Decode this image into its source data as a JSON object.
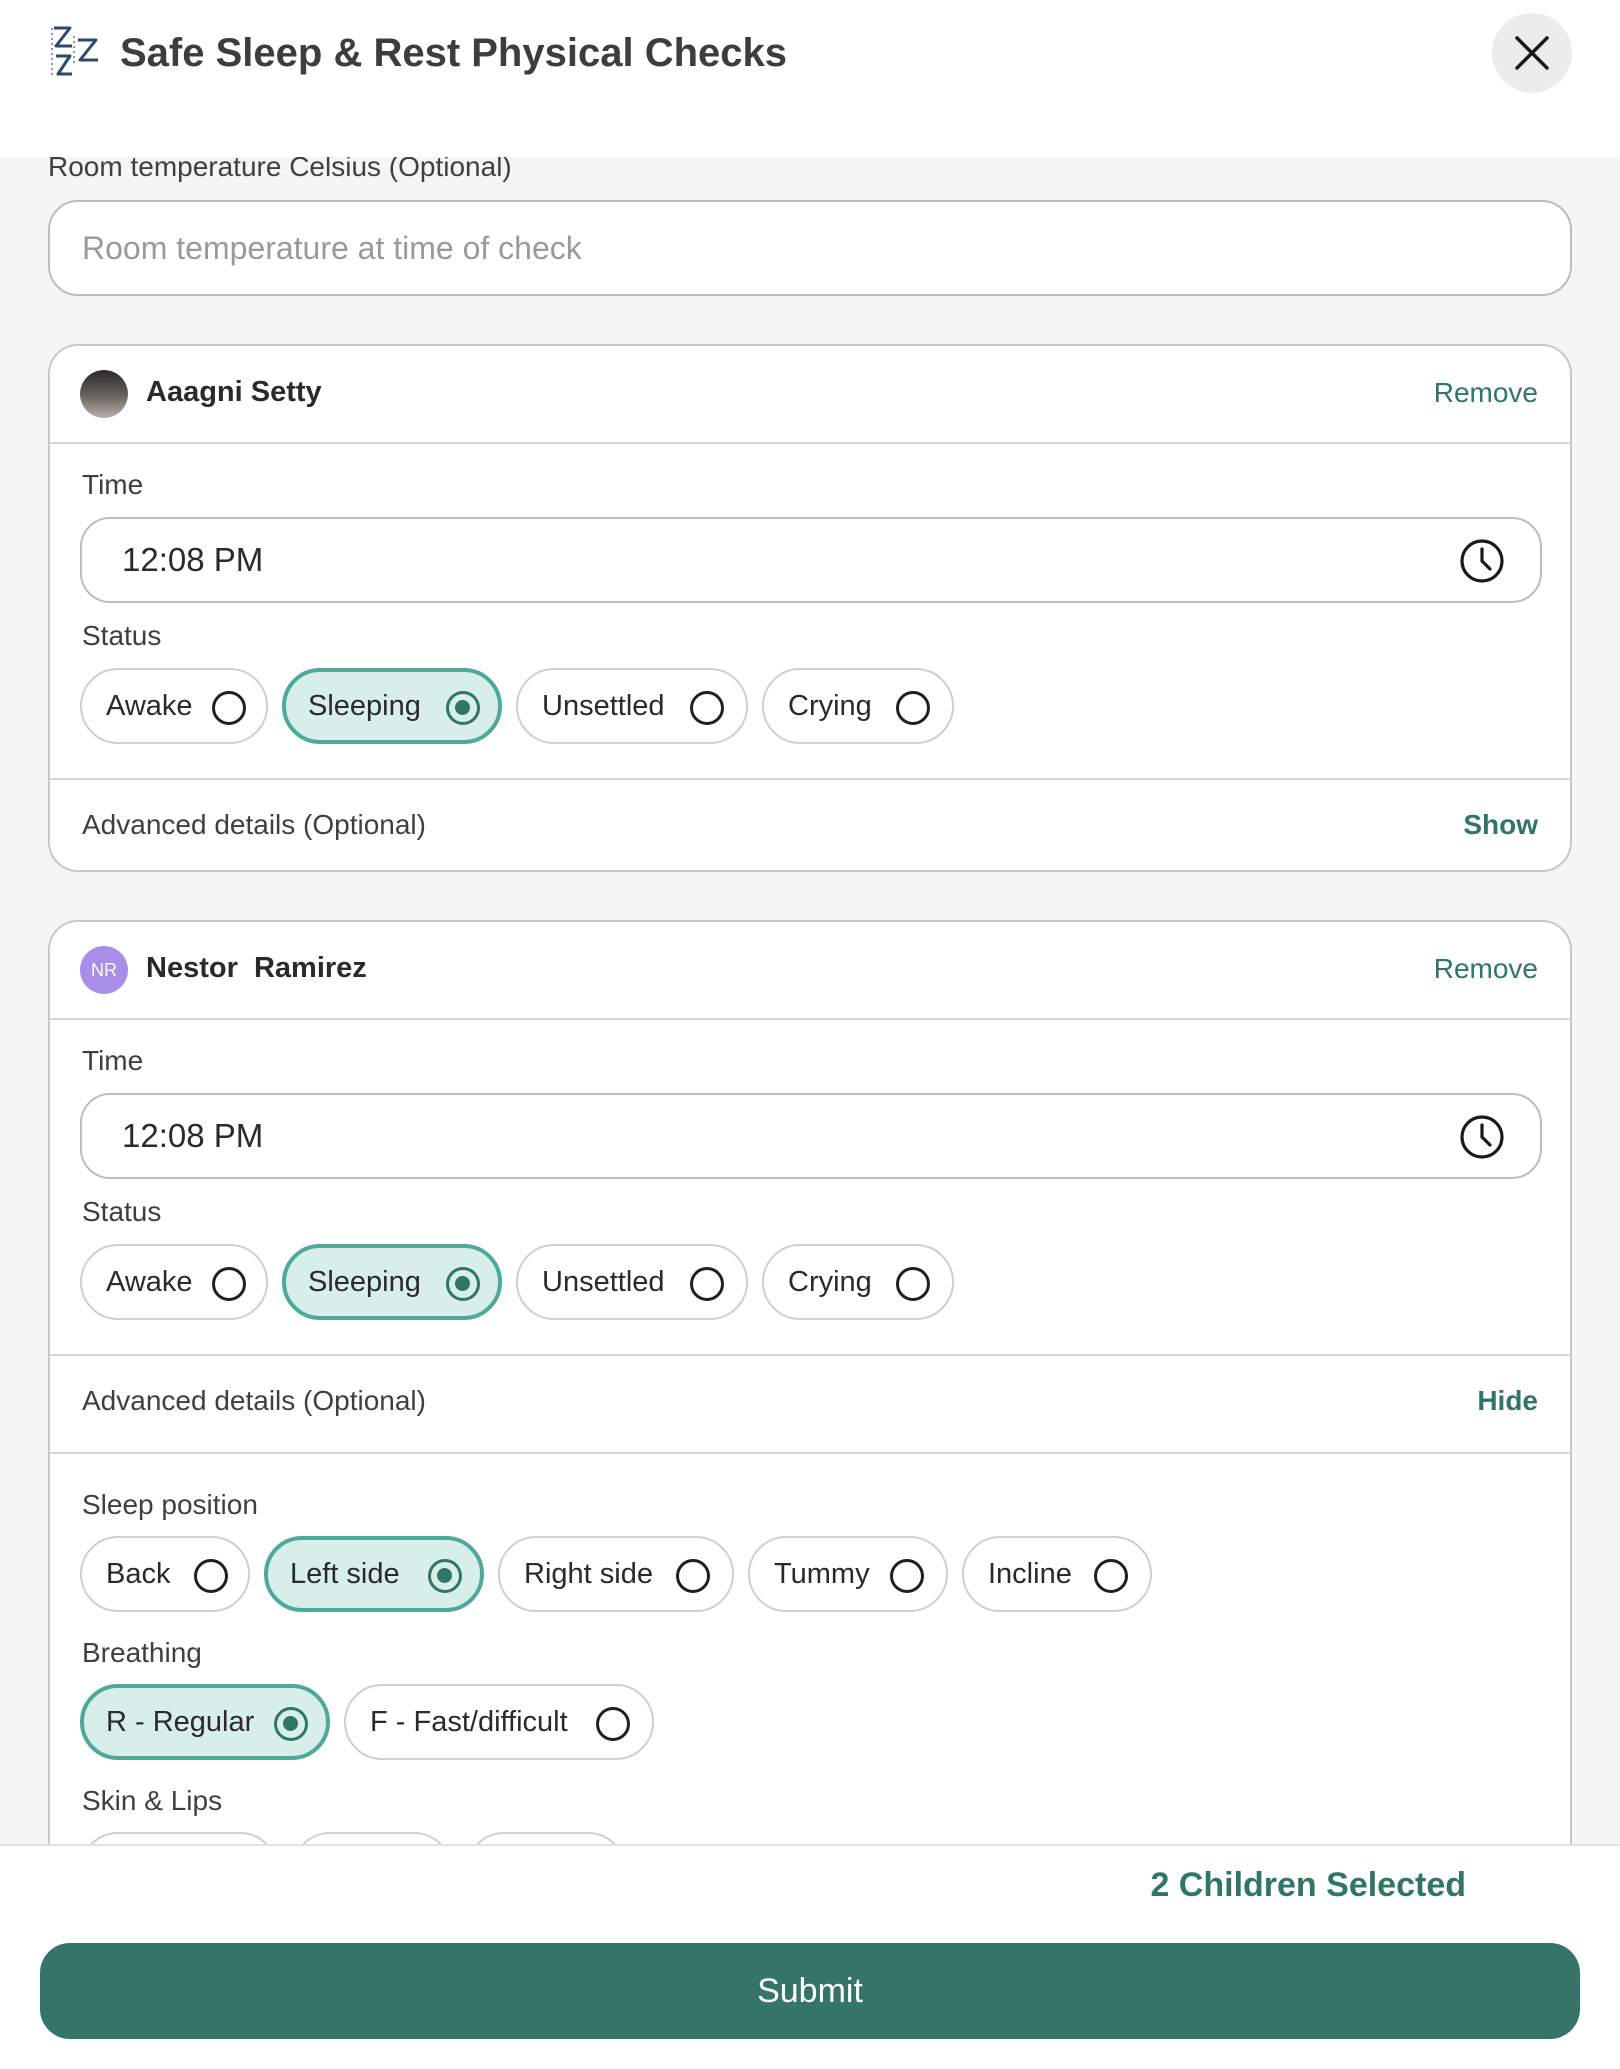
{
  "header": {
    "title": "Safe Sleep & Rest Physical Checks",
    "logo_icon": "zzz-sleep-icon",
    "close_icon": "close-icon"
  },
  "room_temperature": {
    "label": "Room temperature Celsius (Optional)",
    "placeholder": "Room temperature at time of check",
    "value": ""
  },
  "children": [
    {
      "name": "Aaagni Setty",
      "avatar": "photo",
      "remove_label": "Remove",
      "time_label": "Time",
      "time_value": "12:08 PM",
      "status_label": "Status",
      "status_options": [
        "Awake",
        "Sleeping",
        "Unsettled",
        "Crying"
      ],
      "status_selected": "Sleeping",
      "advanced_label": "Advanced details (Optional)",
      "advanced_toggle": "Show"
    },
    {
      "name": "Nestor  Ramirez",
      "initials": "NR",
      "remove_label": "Remove",
      "time_label": "Time",
      "time_value": "12:08 PM",
      "status_label": "Status",
      "status_options": [
        "Awake",
        "Sleeping",
        "Unsettled",
        "Crying"
      ],
      "status_selected": "Sleeping",
      "advanced_label": "Advanced details (Optional)",
      "advanced_toggle": "Hide",
      "sleep_position_label": "Sleep position",
      "sleep_position_options": [
        "Back",
        "Left side",
        "Right side",
        "Tummy",
        "Incline"
      ],
      "sleep_position_selected": "Left side",
      "breathing_label": "Breathing",
      "breathing_options": [
        "R - Regular",
        "F - Fast/difficult"
      ],
      "breathing_selected": "R - Regular",
      "skin_lips_label": "Skin & Lips"
    }
  ],
  "footer": {
    "selected_count": "2 Children Selected",
    "submit_label": "Submit"
  },
  "colors": {
    "accent": "#2f7568",
    "button": "#357468",
    "selected_bg": "#d8eeeb",
    "selected_border": "#4ea99b",
    "avatar_initials_bg": "#a88ee8"
  }
}
